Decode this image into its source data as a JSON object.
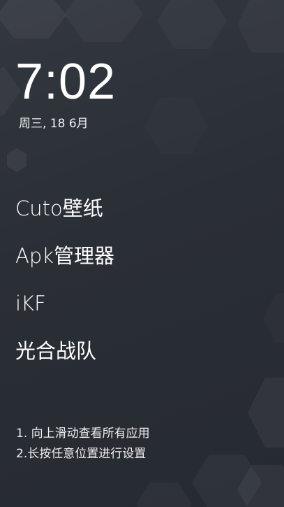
{
  "clock": {
    "time": "7:02",
    "date": "周三, 18 6月"
  },
  "apps": [
    {
      "label": "Cuto壁纸"
    },
    {
      "label": "Apk管理器"
    },
    {
      "label": "iKF"
    },
    {
      "label": "光合战队"
    }
  ],
  "hints": {
    "line1": "1. 向上滑动查看所有应用",
    "line2": "2.长按任意位置进行设置"
  },
  "colors": {
    "background": "#2b2f36",
    "text": "#ffffff"
  }
}
